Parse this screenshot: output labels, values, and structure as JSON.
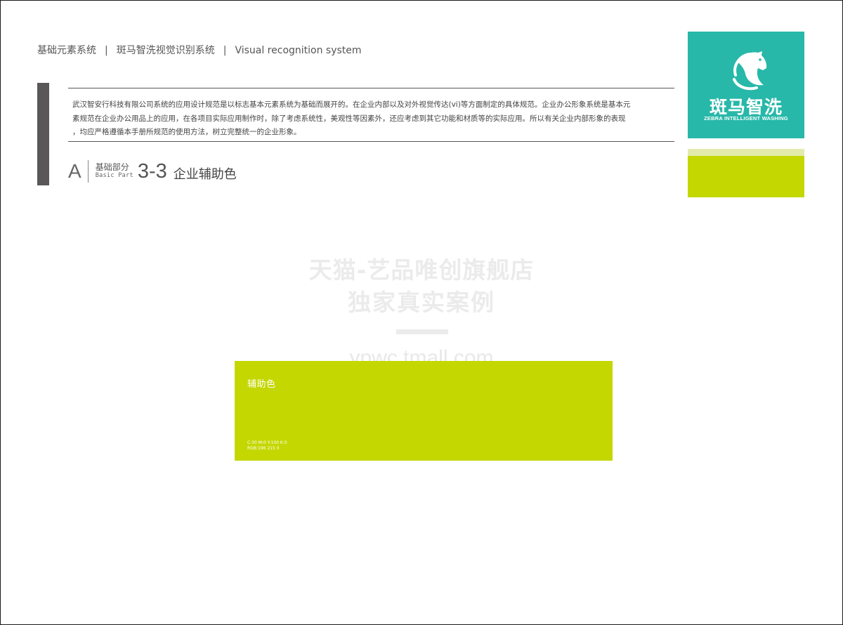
{
  "header": {
    "nav_1": "基础元素系统",
    "separator": "|",
    "nav_2": "斑马智洗视觉识别系统",
    "nav_3": "Visual recognition system"
  },
  "intro": {
    "text": "武汉智安行科技有限公司系统的应用设计规范是以标志基本元素系统为基础而展开的。在企业内部以及对外视觉传达(vi)等方面制定的具体规范。企业办公形象系统是基本元\n素规范在企业办公用品上的应用，在各项目实际应用制作时，除了考虑系统性，美观性等因素外，还应考虑到其它功能和材质等的实际应用。所以有关企业内部形象的表现\n，均应严格遵循本手册所规范的使用方法，树立完整统一的企业形象。"
  },
  "section": {
    "letter": "A",
    "part_cn": "基础部分",
    "part_en": "Basic Part",
    "number": "3-3",
    "title": "企业辅助色"
  },
  "logo": {
    "name_cn": "斑马智洗",
    "name_en": "ZEBRA INTELLIGENT WASHING",
    "icon": "zebra-head-icon",
    "bg_color": "#27b8a9"
  },
  "watermark": {
    "line1": "天猫-艺品唯创旗舰店",
    "line2": "独家真实案例",
    "line3": "ypwc.tmall.com"
  },
  "swatch": {
    "label": "辅助色",
    "cmyk": "C:30 M:0 Y:100 K:0",
    "rgb": "RGB:196 215 0",
    "color": "#c4d700"
  },
  "colors": {
    "accent_light": "#e3ebac",
    "dark_bar": "#595757"
  }
}
